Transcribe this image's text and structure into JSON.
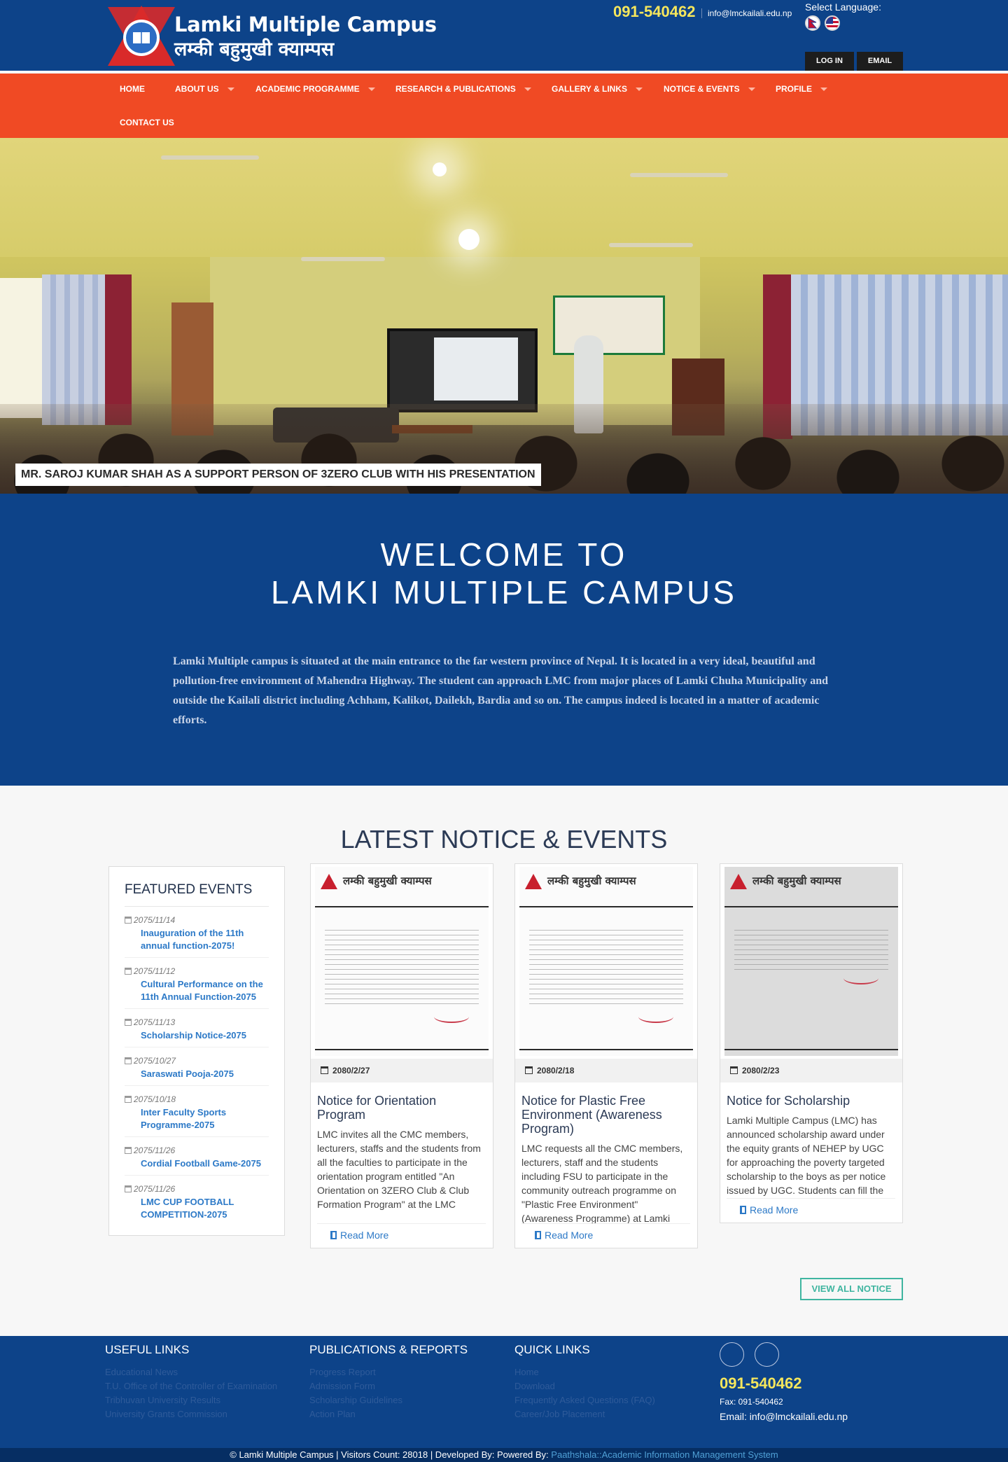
{
  "header": {
    "brand_en": "Lamki Multiple Campus",
    "brand_np": "लम्की बहुमुखी क्याम्पस",
    "phone": "091-540462",
    "email": "info@lmckailali.edu.np",
    "language_label": "Select Language:",
    "login_label": "LOG IN",
    "email_label": "EMAIL"
  },
  "nav": {
    "items": [
      {
        "label": "HOME"
      },
      {
        "label": "ABOUT US"
      },
      {
        "label": "ACADEMIC PROGRAMME"
      },
      {
        "label": "RESEARCH & PUBLICATIONS"
      },
      {
        "label": "GALLERY & LINKS"
      },
      {
        "label": "NOTICE & EVENTS"
      },
      {
        "label": "PROFILE"
      },
      {
        "label": "CONTACT US"
      }
    ]
  },
  "hero": {
    "caption": "MR. SAROJ KUMAR SHAH AS A SUPPORT PERSON OF 3ZERO CLUB WITH HIS PRESENTATION"
  },
  "welcome": {
    "title_line1": "WELCOME TO",
    "title_line2": "LAMKI MULTIPLE CAMPUS",
    "body": "Lamki Multiple campus is situated at the main entrance to the far western province of Nepal. It is located in a very ideal, beautiful and pollution-free environment of Mahendra Highway. The student can approach LMC from major places of Lamki Chuha Municipality and outside the Kailali district including Achham, Kalikot, Dailekh, Bardia and so on. The campus indeed is located in a matter of academic efforts."
  },
  "notices": {
    "section_title": "LATEST NOTICE & EVENTS",
    "featured_title": "FEATURED EVENTS",
    "events": [
      {
        "date": "2075/11/14",
        "title": "Inauguration of the 11th annual function-2075!"
      },
      {
        "date": "2075/11/12",
        "title": "Cultural Performance on the 11th Annual Function-2075"
      },
      {
        "date": "2075/11/13",
        "title": "Scholarship Notice-2075"
      },
      {
        "date": "2075/10/27",
        "title": "Saraswati Pooja-2075"
      },
      {
        "date": "2075/10/18",
        "title": "Inter Faculty Sports Programme-2075"
      },
      {
        "date": "2075/11/26",
        "title": "Cordial Football Game-2075"
      },
      {
        "date": "2075/11/26",
        "title": "LMC CUP FOOTBALL COMPETITION-2075"
      }
    ],
    "cards": [
      {
        "date": "2080/2/27",
        "title": "Notice for Orientation Program",
        "desc": "LMC invites all the CMC members, lecturers, staffs and the students from all the faculties to participate in the orientation program entitled \"An Orientation on 3ZERO Club & Club Formation Program\" at the LMC",
        "more": "Read More"
      },
      {
        "date": "2080/2/18",
        "title": "Notice for Plastic Free Environment (Awareness Program)",
        "desc": "LMC requests all the CMC members, lecturers, staff and the students including FSU to participate in the community outreach programme on \"Plastic Free Environment\" (Awareness Programme) at Lamki",
        "more": "Read More"
      },
      {
        "date": "2080/2/23",
        "title": "Notice for Scholarship",
        "desc": "Lamki Multiple Campus (LMC) has announced scholarship award under the equity grants of NEHEP by UGC for approaching the poverty targeted scholarship to the boys as per notice issued by UGC. Students can fill the",
        "more": "Read More"
      }
    ],
    "view_all": "VIEW ALL NOTICE"
  },
  "footer": {
    "useful_title": "USEFUL LINKS",
    "useful_links": [
      "Educational News",
      "T.U. Office of the Controller of Examination",
      "Tribhuvan University Results",
      "University Grants Commission"
    ],
    "pub_title": "PUBLICATIONS & REPORTS",
    "pub_links": [
      "Progress Report",
      "Admission Form",
      "Scholarship Guidelines",
      "Action Plan"
    ],
    "quick_title": "QUICK LINKS",
    "quick_links": [
      "Home",
      "Download",
      "Frequently Asked Questions (FAQ)",
      "Career/Job Placement"
    ],
    "phone": "091-540462",
    "fax": "Fax: 091-540462",
    "email": "Email: info@lmckailali.edu.np",
    "copyright": "© Lamki Multiple Campus | Visitors Count: 28018 | Developed By:  Powered By:",
    "powered": "Paathshala::Academic Information Management System"
  },
  "colors": {
    "header_blue": "#0d4389",
    "nav_orange": "#f04a24",
    "phone_yellow": "#f5e65c",
    "link_blue": "#2c79c7",
    "view_all_teal": "#3fb5a0"
  }
}
